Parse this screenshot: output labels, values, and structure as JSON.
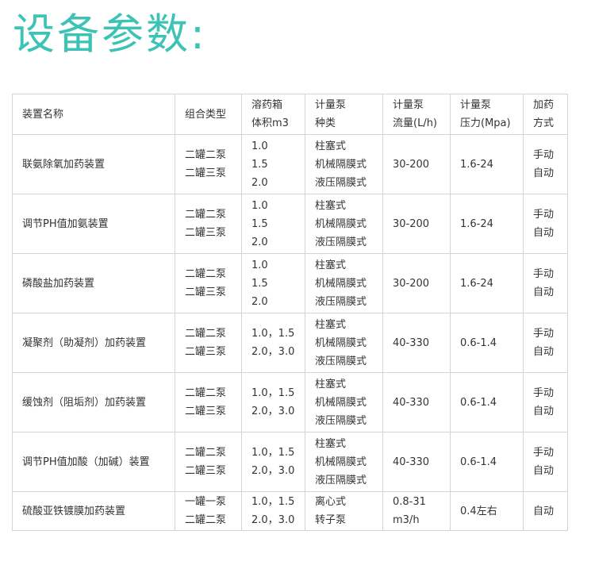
{
  "page": {
    "title": "设备参数:"
  },
  "table": {
    "headers": [
      [
        "装置名称"
      ],
      [
        "组合类型"
      ],
      [
        "溶药箱",
        "体积m3"
      ],
      [
        "计量泵",
        "种类"
      ],
      [
        "计量泵",
        "流量(L/h)"
      ],
      [
        "计量泵",
        "压力(Mpa)"
      ],
      [
        "加药",
        "方式"
      ]
    ],
    "rows": [
      {
        "name": "联氨除氧加药装置",
        "combo": [
          "二罐二泵",
          "二罐三泵"
        ],
        "volume": [
          "1.0",
          "1.5",
          "2.0"
        ],
        "pump_type": [
          "柱塞式",
          "机械隔膜式",
          "液压隔膜式"
        ],
        "flow": [
          "30-200"
        ],
        "pressure": [
          "1.6-24"
        ],
        "method": [
          "手动",
          "自动"
        ]
      },
      {
        "name": "调节PH值加氨装置",
        "combo": [
          "二罐二泵",
          "二罐三泵"
        ],
        "volume": [
          "1.0",
          "1.5",
          "2.0"
        ],
        "pump_type": [
          "柱塞式",
          "机械隔膜式",
          "液压隔膜式"
        ],
        "flow": [
          "30-200"
        ],
        "pressure": [
          "1.6-24"
        ],
        "method": [
          "手动",
          "自动"
        ]
      },
      {
        "name": "磷酸盐加药装置",
        "combo": [
          "二罐二泵",
          "二罐三泵"
        ],
        "volume": [
          "1.0",
          "1.5",
          "2.0"
        ],
        "pump_type": [
          "柱塞式",
          "机械隔膜式",
          "液压隔膜式"
        ],
        "flow": [
          "30-200"
        ],
        "pressure": [
          "1.6-24"
        ],
        "method": [
          "手动",
          "自动"
        ]
      },
      {
        "name": "凝聚剂（助凝剂）加药装置",
        "combo": [
          "二罐二泵",
          "二罐三泵"
        ],
        "volume": [
          "1.0，1.5",
          "2.0，3.0"
        ],
        "pump_type": [
          "柱塞式",
          "机械隔膜式",
          "液压隔膜式"
        ],
        "flow": [
          "40-330"
        ],
        "pressure": [
          "0.6-1.4"
        ],
        "method": [
          "手动",
          "自动"
        ]
      },
      {
        "name": "缓蚀剂（阻垢剂）加药装置",
        "combo": [
          "二罐二泵",
          "二罐三泵"
        ],
        "volume": [
          "1.0，1.5",
          "2.0，3.0"
        ],
        "pump_type": [
          "柱塞式",
          "机械隔膜式",
          "液压隔膜式"
        ],
        "flow": [
          "40-330"
        ],
        "pressure": [
          "0.6-1.4"
        ],
        "method": [
          "手动",
          "自动"
        ]
      },
      {
        "name": "调节PH值加酸（加碱）装置",
        "combo": [
          "二罐二泵",
          "二罐三泵"
        ],
        "volume": [
          "1.0，1.5",
          "2.0，3.0"
        ],
        "pump_type": [
          "柱塞式",
          "机械隔膜式",
          "液压隔膜式"
        ],
        "flow": [
          "40-330"
        ],
        "pressure": [
          "0.6-1.4"
        ],
        "method": [
          "手动",
          "自动"
        ]
      },
      {
        "name": "硫酸亚铁镀膜加药装置",
        "combo": [
          "一罐一泵",
          "二罐二泵"
        ],
        "volume": [
          "1.0，1.5",
          "2.0，3.0"
        ],
        "pump_type": [
          "离心式",
          "转子泵"
        ],
        "flow": [
          "0.8-31",
          "m3/h"
        ],
        "pressure": [
          "0.4左右"
        ],
        "method": [
          "自动"
        ]
      }
    ]
  }
}
